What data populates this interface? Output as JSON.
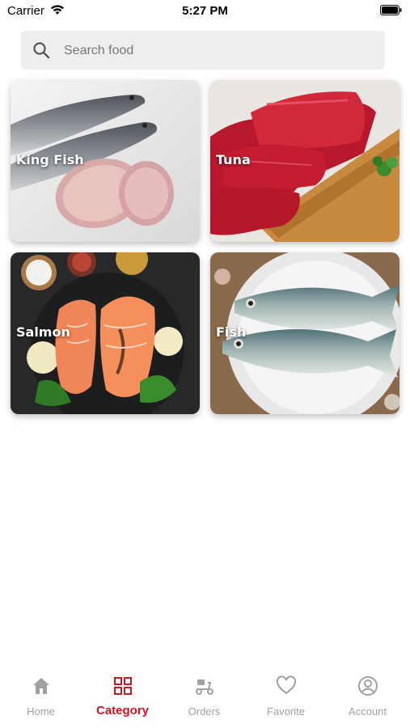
{
  "status_bar": {
    "carrier": "Carrier",
    "time": "5:27 PM"
  },
  "search": {
    "placeholder": "Search food",
    "value": ""
  },
  "categories": [
    {
      "label": "King Fish"
    },
    {
      "label": "Tuna"
    },
    {
      "label": "Salmon"
    },
    {
      "label": "Fish"
    }
  ],
  "tab_bar": {
    "tabs": [
      {
        "label": "Home",
        "icon": "home-icon"
      },
      {
        "label": "Category",
        "icon": "grid-icon",
        "active": true
      },
      {
        "label": "Orders",
        "icon": "scooter-icon"
      },
      {
        "label": "Favorite",
        "icon": "heart-icon"
      },
      {
        "label": "Account",
        "icon": "user-icon"
      }
    ]
  },
  "colors": {
    "accent": "#d11423",
    "inactive": "#a0a0a0",
    "search_bg": "#eeeeee"
  }
}
